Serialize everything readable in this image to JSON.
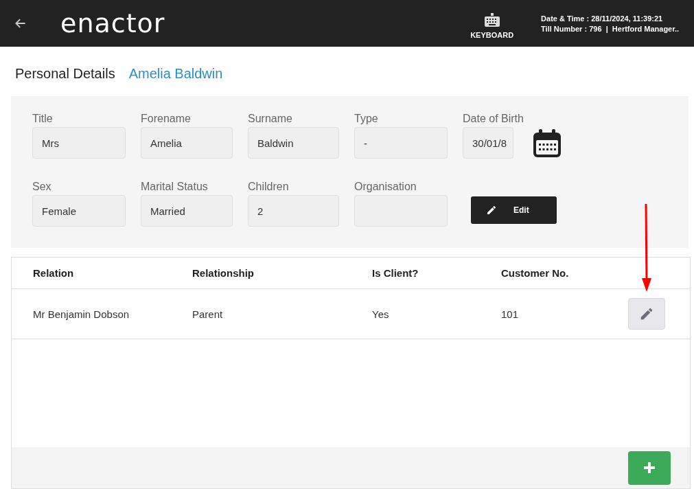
{
  "header": {
    "logo": "enactor",
    "keyboard_label": "KEYBOARD",
    "date_time": "Date & Time : 28/11/2024, 11:39:21",
    "till_info": "Till Number : 796  |  Hertford Manager.."
  },
  "page": {
    "title": "Personal Details",
    "customer_name": "Amelia Baldwin"
  },
  "form": {
    "rows": [
      [
        {
          "label": "Title",
          "value": "Mrs",
          "kind": "text"
        },
        {
          "label": "Forename",
          "value": "Amelia",
          "kind": "text"
        },
        {
          "label": "Surname",
          "value": "Baldwin",
          "kind": "text"
        },
        {
          "label": "Type",
          "value": "-",
          "kind": "text"
        },
        {
          "label": "Date of Birth",
          "value": "30/01/8",
          "kind": "date"
        }
      ],
      [
        {
          "label": "Sex",
          "value": "Female",
          "kind": "text"
        },
        {
          "label": "Marital Status",
          "value": "Married",
          "kind": "text"
        },
        {
          "label": "Children",
          "value": "2",
          "kind": "text"
        },
        {
          "label": "Organisation",
          "kind": "text"
        }
      ]
    ],
    "edit_button": "Edit"
  },
  "table": {
    "columns": [
      "Relation",
      "Relationship",
      "Is Client?",
      "Customer No."
    ],
    "rows": [
      {
        "cells": [
          "Mr Benjamin Dobson",
          "Parent",
          "Yes",
          "101"
        ]
      }
    ]
  }
}
